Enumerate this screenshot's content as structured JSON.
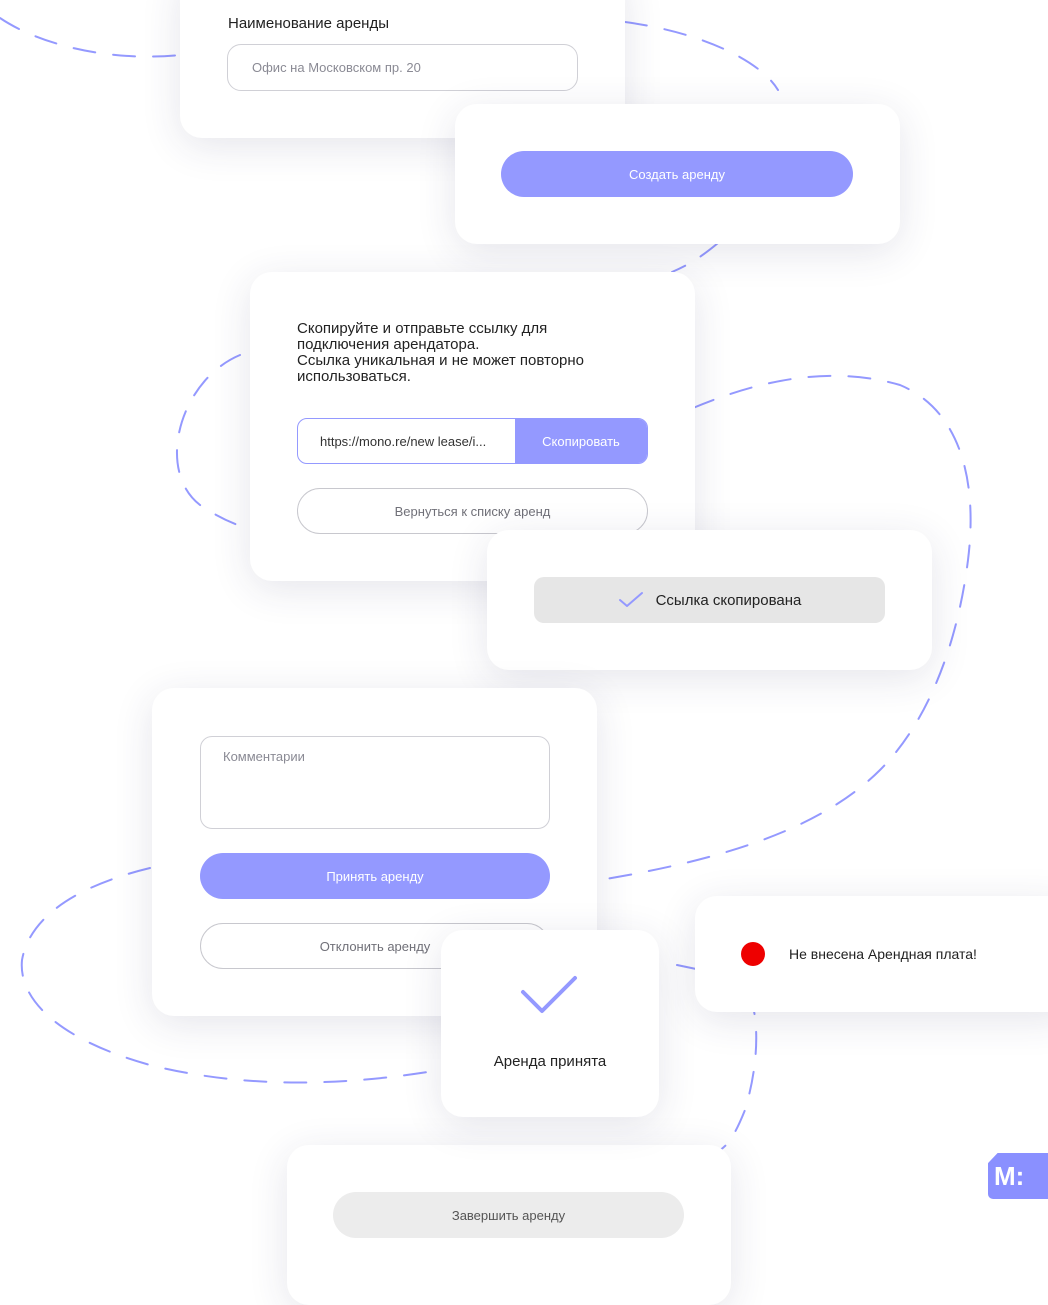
{
  "colors": {
    "accent": "#9499ff",
    "alert": "#ee0000",
    "toast_bg": "#e6e6e6"
  },
  "lease_form": {
    "name_label": "Наименование аренды",
    "name_placeholder": "Офис на Московском пр. 20"
  },
  "create_card": {
    "create_button": "Создать аренду"
  },
  "link_card": {
    "instructions": "Скопируйте и отправьте ссылку для\nподключения арендатора.\nСсылка уникальная и не может повторно\nиспользоваться.",
    "link_value": "https://mono.re/new lease/i...",
    "copy_button": "Скопировать",
    "back_button": "Вернуться к списку аренд"
  },
  "copied_toast": {
    "icon": "check-icon",
    "text": "Ссылка скопирована"
  },
  "accept_card": {
    "comments_placeholder": "Комментарии",
    "accept_button": "Принять аренду",
    "decline_button": "Отклонить аренду"
  },
  "accepted_card": {
    "icon": "check-icon",
    "text": "Аренда принята"
  },
  "rent_alert": {
    "icon": "red-dot-icon",
    "text": "Не внесена Арендная плата!"
  },
  "finish_card": {
    "finish_button": "Завершить аренду"
  },
  "logo": {
    "name": "logo-icon",
    "text": "M:"
  }
}
